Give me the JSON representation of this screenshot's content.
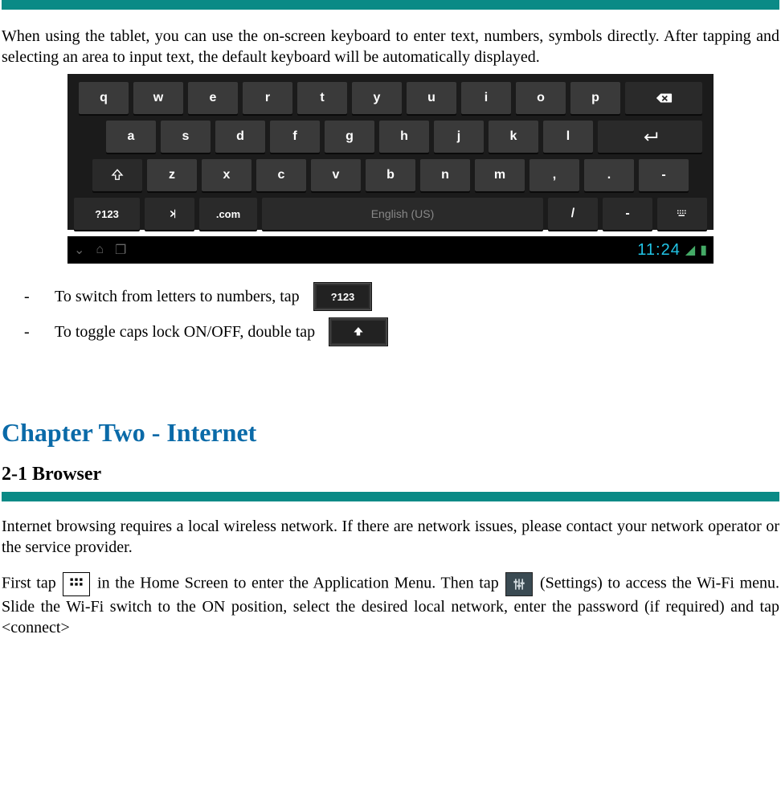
{
  "intro": {
    "p1": "When using the tablet, you can use the on-screen keyboard to enter text, numbers, symbols directly. After tapping and selecting an area to input text, the default keyboard will be automatically displayed."
  },
  "keyboard": {
    "row1": [
      "q",
      "w",
      "e",
      "r",
      "t",
      "y",
      "u",
      "i",
      "o",
      "p"
    ],
    "row2": [
      "a",
      "s",
      "d",
      "f",
      "g",
      "h",
      "j",
      "k",
      "l"
    ],
    "row3": [
      "z",
      "x",
      "c",
      "v",
      "b",
      "n",
      "m",
      ",",
      ".",
      "-"
    ],
    "row4": {
      "numkey": "?123",
      "dotcom": ".com",
      "space": "English (US)",
      "slash": "/",
      "dash": "-"
    },
    "clock": "11:24"
  },
  "bullets": {
    "b1_text": "To switch from letters to numbers, tap",
    "b1_key": "?123",
    "b2_text": "To toggle caps lock ON/OFF, double tap"
  },
  "chapter": {
    "title": "Chapter Two - Internet",
    "section": "2-1 Browser",
    "p1": "Internet browsing requires a local wireless network. If there are network issues, please contact your network operator or the service provider.",
    "p2a": "First tap ",
    "p2b": " in the Home Screen to enter the Application Menu.   Then tap ",
    "p2c": " (Settings) to access the Wi-Fi menu.  Slide the Wi-Fi switch to the ON position, select the desired local network, enter the password (if required) and tap <connect>"
  }
}
